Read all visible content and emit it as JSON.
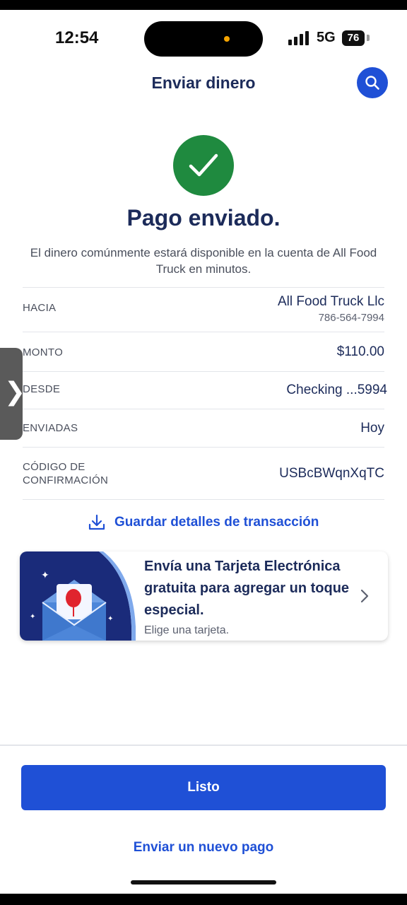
{
  "status_bar": {
    "time": "12:54",
    "network": "5G",
    "battery": "76"
  },
  "header": {
    "title": "Enviar dinero",
    "search_icon": "search-icon"
  },
  "success": {
    "icon": "checkmark-icon",
    "title": "Pago enviado.",
    "message": "El dinero comúnmente estará disponible en la cuenta de All Food Truck en minutos."
  },
  "details": {
    "to_label": "HACIA",
    "to_name": "All Food Truck Llc",
    "to_phone": "786-564-7994",
    "amount_label": "MONTO",
    "amount_value": "$110.00",
    "from_label": "DESDE",
    "from_value": "Checking  ...5994",
    "sent_label": "ENVIADAS",
    "sent_value": "Hoy",
    "confirmation_label_line1": "CÓDIGO DE",
    "confirmation_label_line2": "CONFIRMACIÓN",
    "confirmation_value": "USBcBWqnXqTC"
  },
  "save_link": {
    "icon": "download-icon",
    "label": "Guardar detalles de transacción"
  },
  "promo": {
    "title": "Envía una Tarjeta Electrónica gratuita para agregar un toque especial.",
    "subtitle": "Elige una tarjeta.",
    "art": "envelope-balloon-icon"
  },
  "actions": {
    "done_label": "Listo",
    "new_payment_label": "Enviar un nuevo pago"
  },
  "colors": {
    "accent": "#1f50d6",
    "success": "#1f8a3f",
    "heading": "#1c2b5a"
  }
}
